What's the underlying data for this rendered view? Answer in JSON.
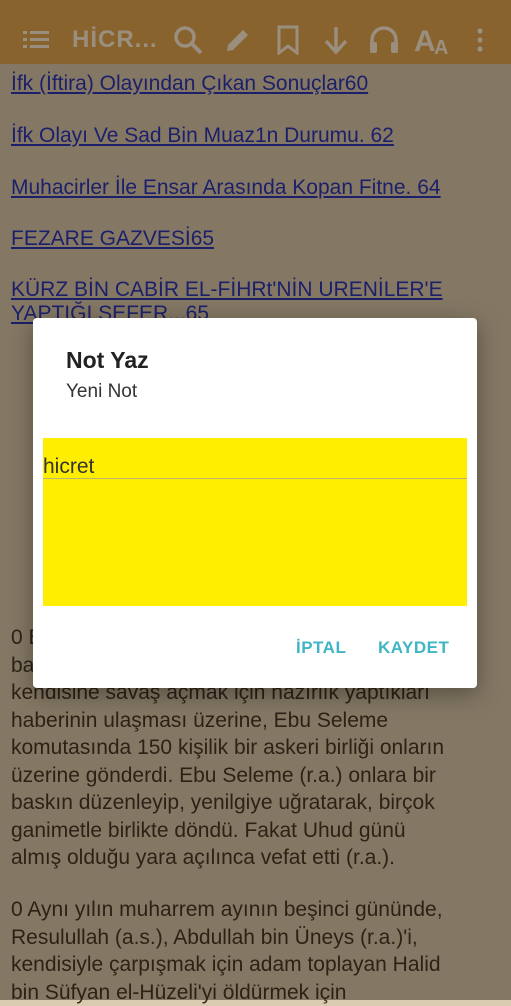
{
  "toolbar": {
    "title": "HİCR...",
    "icons": [
      "menu-icon",
      "search-icon",
      "pencil-icon",
      "bookmark-icon",
      "download-icon",
      "headphones-icon",
      "text-size-icon",
      "more-icon"
    ]
  },
  "toc": [
    "İfk (İftira) Olayından Çıkan Sonuçlar60",
    "İfk Olayı Ve Sad Bin Muaz1n Durumu. 62",
    "Muhacirler İle Ensar Arasında Kopan Fitne. 64",
    "FEZARE GAZVESİ65",
    "KÜRZ BİN CABİR EL-FİHRt'NİN URENİLER'E",
    "YAPTIĞI SEFER...65"
  ],
  "body_text": {
    "p1_line1_partial": "0 E",
    "p1_line2_partial": "ba",
    "p1_lines": [
      "kendisine savaş açmak için hazırlık yaptıkları",
      "haberinin ulaşması üzerine, Ebu Seleme",
      "komutasında 150 kişilik bir askeri birliği onların",
      "üzerine gönderdi. Ebu Seleme (r.a.) onlara bir",
      "baskın düzenleyip, yenilgiye uğratarak, birçok",
      "ganimetle birlikte döndü. Fakat Uhud günü",
      "almış olduğu yara açılınca vefat etti (r.a.)."
    ],
    "p2_lines": [
      "0 Aynı yılın muharrem ayının beşinci gününde,",
      "Resulullah (a.s.), Abdullah bin Üneys (r.a.)'i,",
      "kendisiyle çarpışmak için adam toplayan Halid",
      "bin Süfyan el-Hüzeli'yi öldürmek için"
    ]
  },
  "dialog": {
    "title": "Not Yaz",
    "subtitle": "Yeni Not",
    "note_value": "hicret",
    "cancel_label": "İPTAL",
    "save_label": "KAYDET"
  },
  "colors": {
    "toolbar": "#e0a54a",
    "link": "#1a2ab8",
    "note_background": "#ffee00",
    "dialog_button": "#3fb5c5"
  }
}
